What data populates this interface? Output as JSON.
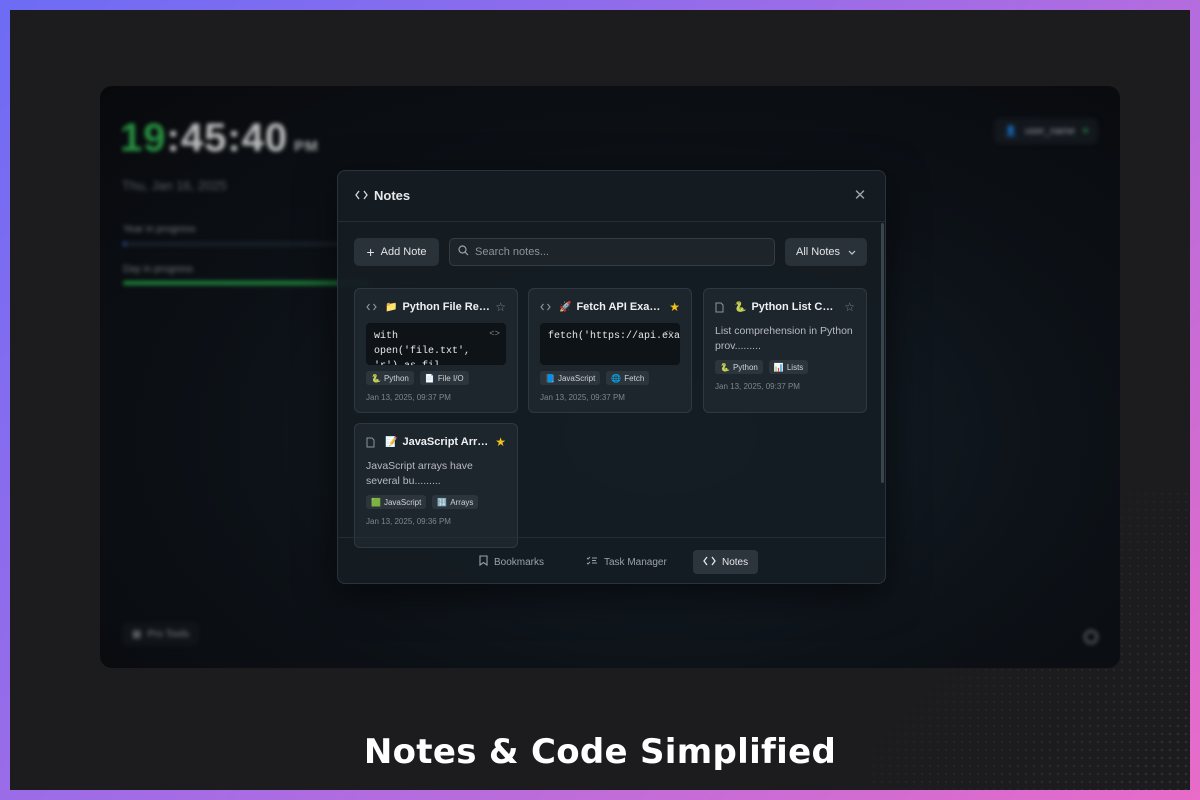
{
  "background": {
    "clock": {
      "hours": "19",
      "rest": ":45:40",
      "ampm": "PM"
    },
    "date": "Thu, Jan 16, 2025",
    "year_progress": {
      "label": "Year in progress",
      "percent": 1
    },
    "day_progress": {
      "label": "Day in progress",
      "percent": 82
    },
    "user": {
      "label": "user_name"
    },
    "focus_mode": {
      "label": "Pro Tools"
    }
  },
  "modal": {
    "title": "Notes",
    "toolbar": {
      "add_label": "Add Note",
      "search_placeholder": "Search notes...",
      "filter_label": "All Notes"
    },
    "cards": [
      {
        "type": "code",
        "emoji": "📁",
        "title": "Python File Read",
        "starred": false,
        "code": "with open('file.txt', 'r') as fil.........",
        "tags": [
          {
            "icon": "🐍",
            "label": "Python"
          },
          {
            "icon": "📄",
            "label": "File I/O"
          }
        ],
        "date": "Jan 13, 2025, 09:37 PM"
      },
      {
        "type": "code",
        "emoji": "🚀",
        "title": "Fetch API Example",
        "starred": true,
        "code": "fetch('https://api.example.com/da.........",
        "tags": [
          {
            "icon": "📘",
            "label": "JavaScript"
          },
          {
            "icon": "🌐",
            "label": "Fetch"
          }
        ],
        "date": "Jan 13, 2025, 09:37 PM"
      },
      {
        "type": "text",
        "emoji": "🐍",
        "title": "Python List Com...",
        "starred": false,
        "text": "List comprehension in Python prov.........",
        "tags": [
          {
            "icon": "🐍",
            "label": "Python"
          },
          {
            "icon": "📊",
            "label": "Lists"
          }
        ],
        "date": "Jan 13, 2025, 09:37 PM"
      },
      {
        "type": "text",
        "emoji": "📝",
        "title": "JavaScript Arra...",
        "starred": true,
        "text": "JavaScript arrays have several bu.........",
        "tags": [
          {
            "icon": "🟩",
            "label": "JavaScript"
          },
          {
            "icon": "🔢",
            "label": "Arrays"
          }
        ],
        "date": "Jan 13, 2025, 09:36 PM"
      }
    ],
    "nav": [
      {
        "label": "Bookmarks",
        "icon": "bookmark-icon",
        "active": false
      },
      {
        "label": "Task Manager",
        "icon": "checklist-icon",
        "active": false
      },
      {
        "label": "Notes",
        "icon": "code-icon",
        "active": true
      }
    ]
  },
  "caption": "Notes & Code Simplified",
  "colors": {
    "accent_green": "#2fb34d",
    "star": "#f4c21b",
    "panel": "#151d23"
  }
}
